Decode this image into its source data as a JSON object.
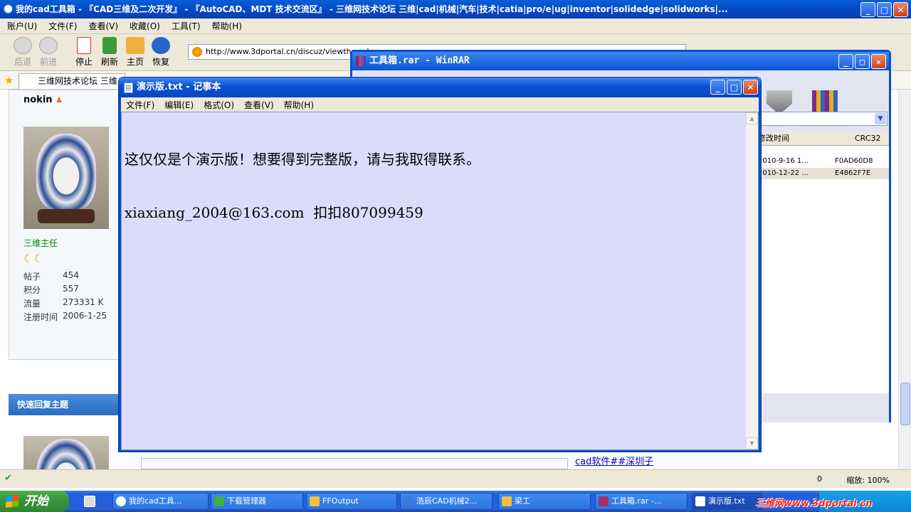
{
  "browser": {
    "title": "我的cad工具箱 - 『CAD三维及二次开发』 - 『AutoCAD、MDT 技术交流区』 - 三维网技术论坛 三维|cad|机械|汽车|技术|catia|pro/e|ug|inventor|solidedge|solidworks|...",
    "menu": [
      "账户(U)",
      "文件(F)",
      "查看(V)",
      "收藏(O)",
      "工具(T)",
      "帮助(H)"
    ],
    "toolbar": {
      "back": "后退",
      "forward": "前进",
      "stop": "停止",
      "refresh": "刷新",
      "home": "主页",
      "restore": "恢复"
    },
    "address": "http://www.3dportal.cn/discuz/viewthread",
    "tab_label": "三维网技术论坛 三维",
    "zoom_label": "缩放: 100%",
    "status_count": "0"
  },
  "post": {
    "username": "nokin",
    "rank": "三维主任",
    "stats": [
      {
        "label": "帖子",
        "value": "454"
      },
      {
        "label": "积分",
        "value": "557"
      },
      {
        "label": "流量",
        "value": "273331 K"
      },
      {
        "label": "注册时间",
        "value": "2006-1-25"
      }
    ],
    "quick_reply": "快速回复主题",
    "link_text": "cad软件##深圳子"
  },
  "winrar": {
    "title": "工具箱.rar - WinRAR",
    "tools": [
      {
        "label": "保护"
      },
      {
        "label": "自解压格式"
      }
    ],
    "columns": {
      "modified": "修改时间",
      "crc": "CRC32"
    },
    "rows": [
      {
        "modified": "2010-9-16 1...",
        "crc": "F0AD60D8"
      },
      {
        "modified": "2010-12-22 ...",
        "crc": "E4862F7E"
      }
    ]
  },
  "notepad": {
    "title": "演示版.txt - 记事本",
    "menu": [
      "文件(F)",
      "编辑(E)",
      "格式(O)",
      "查看(V)",
      "帮助(H)"
    ],
    "line1": "这仅仅是个演示版！想要得到完整版，请与我取得联系。",
    "line2": "xiaxiang_2004@163.com  扣扣807099459"
  },
  "taskbar": {
    "start": "开始",
    "tasks": [
      {
        "label": "我的cad工具...",
        "color": "#ffffff"
      },
      {
        "label": "下载管理器",
        "color": "#40b040"
      },
      {
        "label": "FFOutput",
        "color": "#f0c040"
      },
      {
        "label": "浩辰CAD机械2...",
        "color": "#3a7ad8"
      },
      {
        "label": "梁工",
        "color": "#f0c040"
      },
      {
        "label": "工具箱.rar -...",
        "color": "#a0306a"
      },
      {
        "label": "演示版.txt",
        "color": "#ffffff"
      }
    ],
    "watermark": "三维网www.3dportal.cn"
  }
}
